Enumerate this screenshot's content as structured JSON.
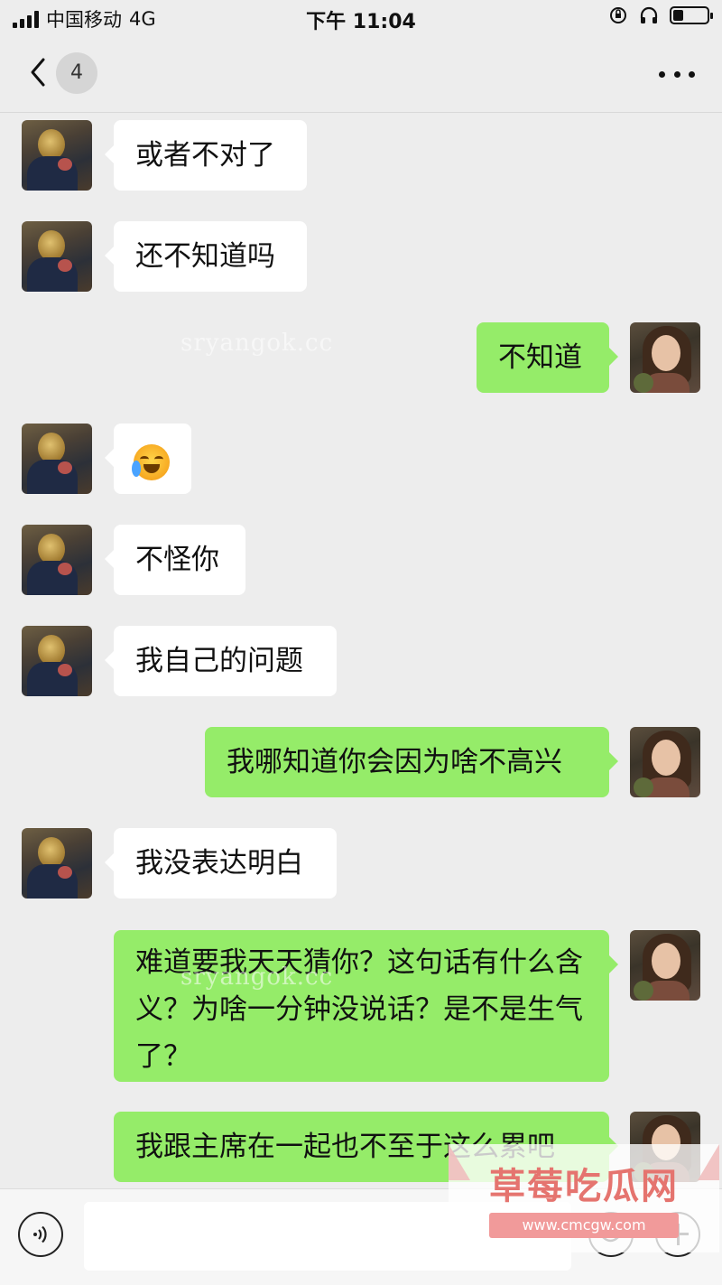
{
  "status_bar": {
    "carrier": "中国移动",
    "network": "4G",
    "time": "下午 11:04",
    "battery_level": 0.3
  },
  "nav": {
    "unread_count": "4"
  },
  "messages": [
    {
      "side": "in",
      "kind": "text",
      "text": "或者不对了"
    },
    {
      "side": "in",
      "kind": "text",
      "text": "还不知道吗"
    },
    {
      "side": "out",
      "kind": "text",
      "text": "不知道"
    },
    {
      "side": "in",
      "kind": "emoji",
      "emoji": "crying-laughing-emoji"
    },
    {
      "side": "in",
      "kind": "text",
      "text": "不怪你"
    },
    {
      "side": "in",
      "kind": "text",
      "text": "我自己的问题"
    },
    {
      "side": "out",
      "kind": "text",
      "text": "我哪知道你会因为啥不高兴"
    },
    {
      "side": "in",
      "kind": "text",
      "text": "我没表达明白"
    },
    {
      "side": "out",
      "kind": "text",
      "text": "难道要我天天猜你？这句话有什么含义？为啥一分钟没说话？是不是生气了？"
    },
    {
      "side": "out",
      "kind": "text",
      "text": "我跟主席在一起也不至于这么累吧"
    }
  ],
  "input": {
    "placeholder": ""
  },
  "watermarks": {
    "faint_1": "sryangok.cc",
    "faint_2": "sryangok.cc",
    "box_title": "草莓吃瓜网",
    "box_url": "www.cmcgw.com"
  },
  "icons": {
    "back": "chevron-left-icon",
    "more": "more-dots-icon",
    "voice": "voice-icon",
    "emoji": "emoji-icon",
    "plus": "plus-icon"
  }
}
